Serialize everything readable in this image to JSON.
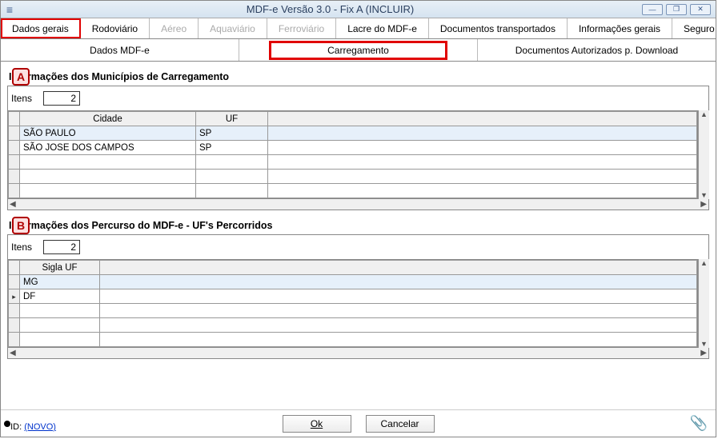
{
  "window": {
    "title": "MDF-e Versão 3.0 - Fix A (INCLUIR)"
  },
  "tabs": [
    {
      "label": "Dados gerais",
      "selected": true,
      "disabled": false
    },
    {
      "label": "Rodoviário",
      "selected": false,
      "disabled": false
    },
    {
      "label": "Aéreo",
      "selected": false,
      "disabled": true
    },
    {
      "label": "Aquaviário",
      "selected": false,
      "disabled": true
    },
    {
      "label": "Ferroviário",
      "selected": false,
      "disabled": true
    },
    {
      "label": "Lacre do MDF-e",
      "selected": false,
      "disabled": false
    },
    {
      "label": "Documentos transportados",
      "selected": false,
      "disabled": false
    },
    {
      "label": "Informações gerais",
      "selected": false,
      "disabled": false
    },
    {
      "label": "Seguro",
      "selected": false,
      "disabled": false
    }
  ],
  "subtabs": [
    {
      "label": "Dados MDF-e",
      "selected": false
    },
    {
      "label": "Carregamento",
      "selected": true
    },
    {
      "label": "Documentos Autorizados p. Download",
      "selected": false
    }
  ],
  "sectionA": {
    "badge": "A",
    "title": "Informações dos Municípios de Carregamento",
    "itens_label": "Itens",
    "itens_value": "2",
    "columns": {
      "cidade": "Cidade",
      "uf": "UF"
    },
    "rows": [
      {
        "cidade": "SÃO PAULO",
        "uf": "SP",
        "highlight": true
      },
      {
        "cidade": "SÃO JOSE DOS CAMPOS",
        "uf": "SP",
        "highlight": false
      }
    ]
  },
  "sectionB": {
    "badge": "B",
    "title": "Informações dos Percurso do MDF-e - UF's Percorridos",
    "itens_label": "Itens",
    "itens_value": "2",
    "columns": {
      "sigla": "Sigla UF"
    },
    "rows": [
      {
        "sigla": "MG",
        "highlight": true,
        "marker": false
      },
      {
        "sigla": "DF",
        "highlight": false,
        "marker": true
      }
    ]
  },
  "buttons": {
    "ok": "Ok",
    "cancel": "Cancelar"
  },
  "status": {
    "id_label": "ID:",
    "id_value": "(NOVO)"
  },
  "icons": {
    "menu": "≡",
    "minimize": "—",
    "restore": "❐",
    "close": "✕",
    "scroll_left": "◀",
    "scroll_right": "▶",
    "scroll_up": "▲",
    "scroll_down": "▼",
    "clip": "📎"
  }
}
